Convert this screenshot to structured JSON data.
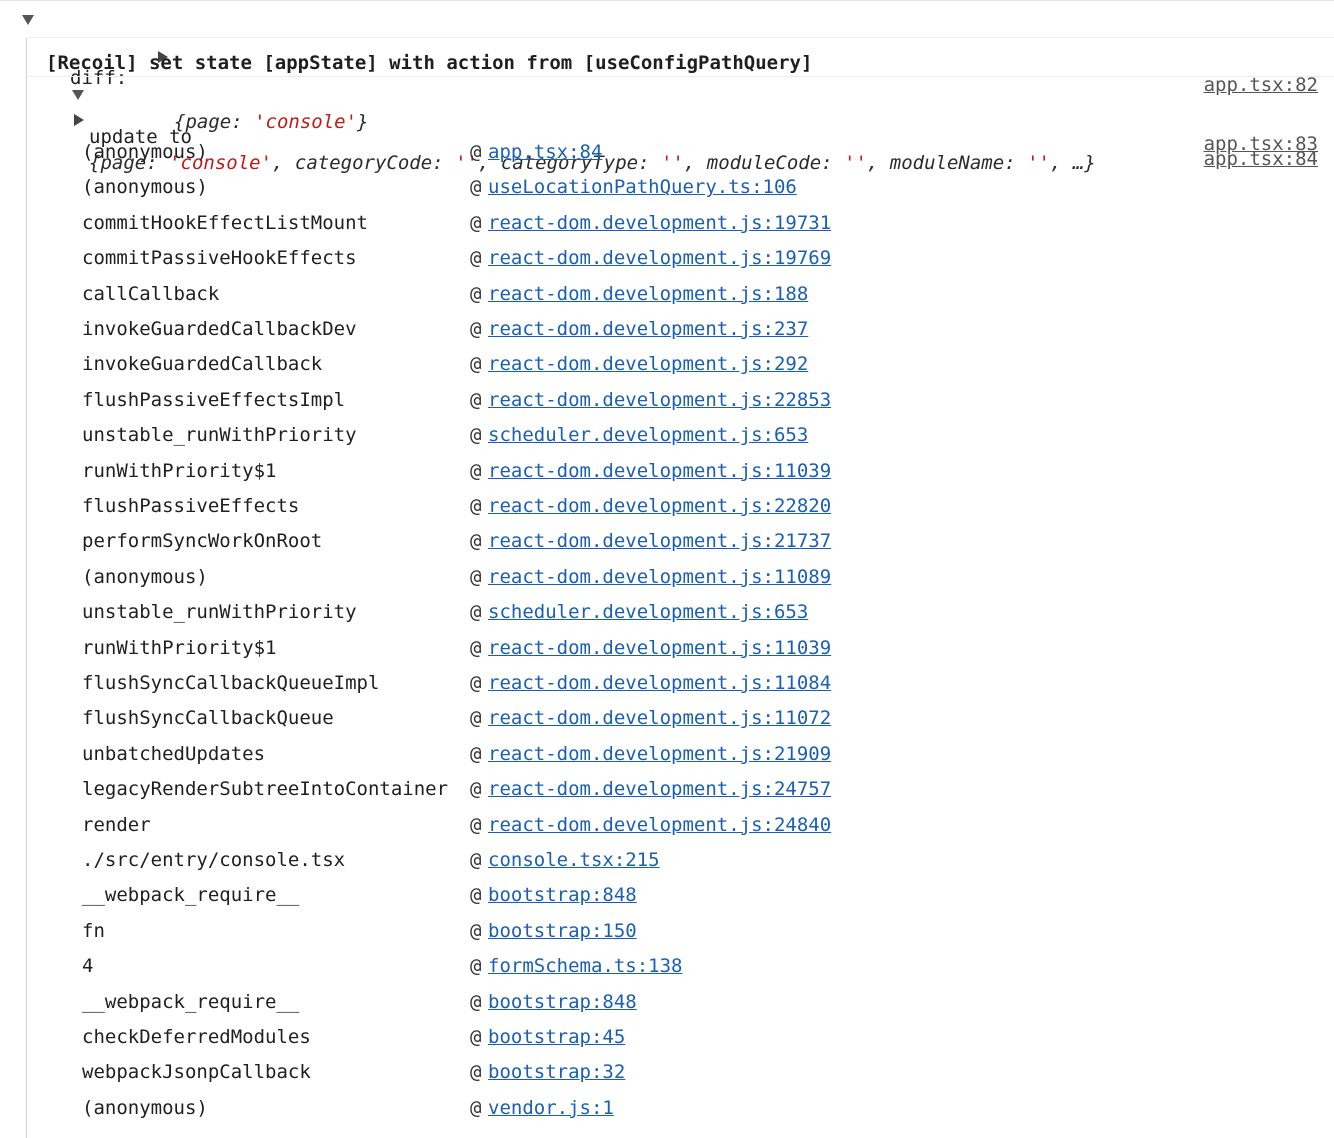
{
  "group": {
    "title": "[Recoil] set state [appState] with action from [useConfigPathQuery]",
    "source": "app.tsx:82"
  },
  "diff": {
    "label": "diff:",
    "preview": "{page: 'console'}",
    "source": "app.tsx:83"
  },
  "update": {
    "label": "update to",
    "source": "app.tsx:84",
    "preview": "{page: 'console', categoryCode: '', categoryType: '', moduleCode: '', moduleName: '', …}"
  },
  "stack": [
    {
      "fn": "(anonymous)",
      "at": "@",
      "link": "app.tsx:84"
    },
    {
      "fn": "(anonymous)",
      "at": "@",
      "link": "useLocationPathQuery.ts:106"
    },
    {
      "fn": "commitHookEffectListMount",
      "at": "@",
      "link": "react-dom.development.js:19731"
    },
    {
      "fn": "commitPassiveHookEffects",
      "at": "@",
      "link": "react-dom.development.js:19769"
    },
    {
      "fn": "callCallback",
      "at": "@",
      "link": "react-dom.development.js:188"
    },
    {
      "fn": "invokeGuardedCallbackDev",
      "at": "@",
      "link": "react-dom.development.js:237"
    },
    {
      "fn": "invokeGuardedCallback",
      "at": "@",
      "link": "react-dom.development.js:292"
    },
    {
      "fn": "flushPassiveEffectsImpl",
      "at": "@",
      "link": "react-dom.development.js:22853"
    },
    {
      "fn": "unstable_runWithPriority",
      "at": "@",
      "link": "scheduler.development.js:653"
    },
    {
      "fn": "runWithPriority$1",
      "at": "@",
      "link": "react-dom.development.js:11039"
    },
    {
      "fn": "flushPassiveEffects",
      "at": "@",
      "link": "react-dom.development.js:22820"
    },
    {
      "fn": "performSyncWorkOnRoot",
      "at": "@",
      "link": "react-dom.development.js:21737"
    },
    {
      "fn": "(anonymous)",
      "at": "@",
      "link": "react-dom.development.js:11089"
    },
    {
      "fn": "unstable_runWithPriority",
      "at": "@",
      "link": "scheduler.development.js:653"
    },
    {
      "fn": "runWithPriority$1",
      "at": "@",
      "link": "react-dom.development.js:11039"
    },
    {
      "fn": "flushSyncCallbackQueueImpl",
      "at": "@",
      "link": "react-dom.development.js:11084"
    },
    {
      "fn": "flushSyncCallbackQueue",
      "at": "@",
      "link": "react-dom.development.js:11072"
    },
    {
      "fn": "unbatchedUpdates",
      "at": "@",
      "link": "react-dom.development.js:21909"
    },
    {
      "fn": "legacyRenderSubtreeIntoContainer",
      "at": "@",
      "link": "react-dom.development.js:24757"
    },
    {
      "fn": "render",
      "at": "@",
      "link": "react-dom.development.js:24840"
    },
    {
      "fn": "./src/entry/console.tsx",
      "at": "@",
      "link": "console.tsx:215"
    },
    {
      "fn": "__webpack_require__",
      "at": "@",
      "link": "bootstrap:848"
    },
    {
      "fn": "fn",
      "at": "@",
      "link": "bootstrap:150"
    },
    {
      "fn": "4",
      "at": "@",
      "link": "formSchema.ts:138"
    },
    {
      "fn": "__webpack_require__",
      "at": "@",
      "link": "bootstrap:848"
    },
    {
      "fn": "checkDeferredModules",
      "at": "@",
      "link": "bootstrap:45"
    },
    {
      "fn": "webpackJsonpCallback",
      "at": "@",
      "link": "bootstrap:32"
    },
    {
      "fn": "(anonymous)",
      "at": "@",
      "link": "vendor.js:1"
    }
  ]
}
